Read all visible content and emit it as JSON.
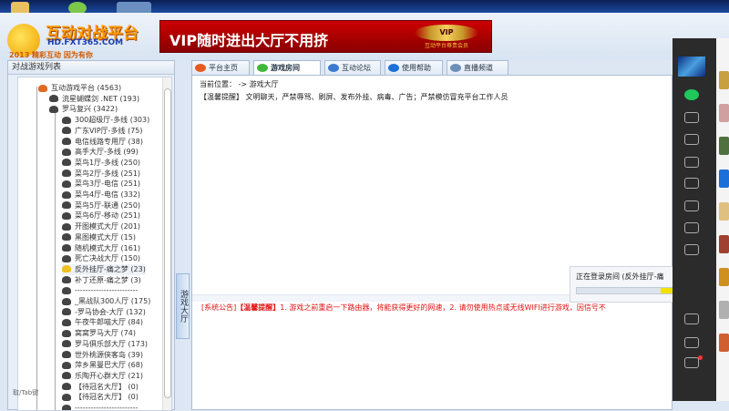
{
  "header": {
    "logo_title": "互动对战平台",
    "logo_url": "HD.FXT365.COM",
    "logo_slogan": "2013 精彩互动 因为有你",
    "banner_text": "VIP随时进出大厅不用挤",
    "banner_badge": "VIP",
    "banner_badge_caption": "互动平台尊贵会员"
  },
  "left_panel": {
    "title": "对战游戏列表",
    "hint": "取/Tab键",
    "tree": [
      {
        "label": "互动游戏平台 (4563)",
        "level": 0
      },
      {
        "label": "流星蝴蝶剑 .NET (193)",
        "level": 1
      },
      {
        "label": "罗马复兴 (3422)",
        "level": 1
      },
      {
        "label": "300超级厅-多线 (303)",
        "level": 2
      },
      {
        "label": "广东VIP厅-多线 (75)",
        "level": 2
      },
      {
        "label": "电信线路专用厅 (38)",
        "level": 2
      },
      {
        "label": "高手大厅-多线 (99)",
        "level": 2
      },
      {
        "label": "菜鸟1厅-多线 (250)",
        "level": 2
      },
      {
        "label": "菜鸟2厅-多线 (251)",
        "level": 2
      },
      {
        "label": "菜鸟3厅-电信 (251)",
        "level": 2
      },
      {
        "label": "菜鸟4厅-电信 (332)",
        "level": 2
      },
      {
        "label": "菜鸟5厅-联通 (250)",
        "level": 2
      },
      {
        "label": "菜鸟6厅-移动 (251)",
        "level": 2
      },
      {
        "label": "开图模式大厅 (201)",
        "level": 2
      },
      {
        "label": "黑图模式大厅 (15)",
        "level": 2
      },
      {
        "label": "随机模式大厅 (161)",
        "level": 2
      },
      {
        "label": "死亡决战大厅 (150)",
        "level": 2
      },
      {
        "label": "反外挂厅-痛之梦 (23)",
        "level": 2,
        "selected": true
      },
      {
        "label": "补丁还原-痛之梦 (3)",
        "level": 2
      },
      {
        "label": "------------------------",
        "level": 2
      },
      {
        "label": "_黑战队300人厅 (175)",
        "level": 2
      },
      {
        "label": "-罗马协会-大厅 (132)",
        "level": 2
      },
      {
        "label": "午夜牛郎喵大厅 (84)",
        "level": 2
      },
      {
        "label": "窝窝罗马大厅 (74)",
        "level": 2
      },
      {
        "label": "罗马俱乐部大厅 (173)",
        "level": 2
      },
      {
        "label": "世外桃源侠客岛 (39)",
        "level": 2
      },
      {
        "label": "萍乡黑曼巴大厅 (68)",
        "level": 2
      },
      {
        "label": "乐陶开心群大厅 (21)",
        "level": 2
      },
      {
        "label": "【待冠名大厅】 (0)",
        "level": 2
      },
      {
        "label": "【待冠名大厅】 (0)",
        "level": 2
      },
      {
        "label": "------------------------",
        "level": 2
      }
    ]
  },
  "vertical_tab": "游戏大厅",
  "tabs": [
    {
      "label": "平台主页",
      "icon": "home-icon",
      "color": "#e85a20"
    },
    {
      "label": "游戏房间",
      "icon": "chat-bubble-icon",
      "color": "#3fb83a",
      "active": true
    },
    {
      "label": "互动论坛",
      "icon": "users-icon",
      "color": "#3a7ad0"
    },
    {
      "label": "使用帮助",
      "icon": "help-icon",
      "color": "#1a6fd8"
    },
    {
      "label": "直播频道",
      "icon": "broadcast-icon",
      "color": "#6a8fb8"
    }
  ],
  "main": {
    "location_label": "当前位置：",
    "location_path": "-> 游戏大厅",
    "notice": "【温馨提醒】 文明聊天，严禁辱骂、刷屏、发布外挂、病毒、广告；严禁模仿冒充平台工作人员",
    "announce_prefix": "[系统公告]",
    "announce_tag": "【温馨提醒】",
    "announce_text": "1. 游戏之前重启一下路由器，将能获得更好的网速，2. 请勿使用热点或无线WIFI进行游戏，因信号不"
  },
  "popup": {
    "text": "正在登录房间 (反外挂厅-痛",
    "progress": 0.15
  },
  "dock_icons": [
    "avatar",
    "chat-icon",
    "contacts-icon",
    "box-icon",
    "folder-icon",
    "aperture-icon",
    "butterfly-icon",
    "flower-icon",
    "sparkle-icon",
    "compass-icon",
    "tablet-icon",
    "menu-icon"
  ],
  "colors": {
    "accent": "#c00000",
    "announce": "#e01010",
    "dock": "#2b2b2b"
  }
}
